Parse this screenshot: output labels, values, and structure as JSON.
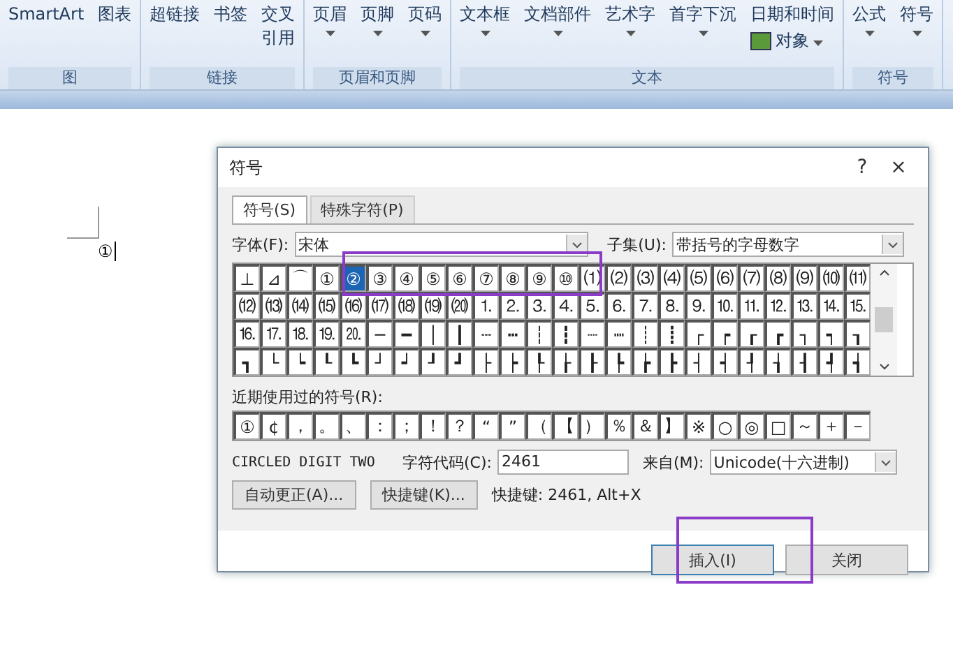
{
  "ribbon": {
    "groups": [
      {
        "label": "图",
        "buttons": [
          {
            "lines": [
              "SmartArt"
            ],
            "dropdown": false
          },
          {
            "lines": [
              "图表"
            ],
            "dropdown": false
          }
        ]
      },
      {
        "label": "链接",
        "buttons": [
          {
            "lines": [
              "超链接"
            ],
            "dropdown": false
          },
          {
            "lines": [
              "书签"
            ],
            "dropdown": false
          },
          {
            "lines": [
              "交叉",
              "引用"
            ],
            "dropdown": false
          }
        ]
      },
      {
        "label": "页眉和页脚",
        "buttons": [
          {
            "lines": [
              "页眉"
            ],
            "dropdown": true
          },
          {
            "lines": [
              "页脚"
            ],
            "dropdown": true
          },
          {
            "lines": [
              "页码"
            ],
            "dropdown": true
          }
        ]
      },
      {
        "label": "文本",
        "buttons": [
          {
            "lines": [
              "文本框"
            ],
            "dropdown": true
          },
          {
            "lines": [
              "文档部件"
            ],
            "dropdown": true
          },
          {
            "lines": [
              "艺术字"
            ],
            "dropdown": true
          },
          {
            "lines": [
              "首字下沉"
            ],
            "dropdown": true
          }
        ],
        "small_buttons": [
          {
            "label": "日期和时间",
            "dropdown": false
          },
          {
            "label": "对象",
            "dropdown": true
          }
        ]
      },
      {
        "label": "符号",
        "buttons": [
          {
            "lines": [
              "公式"
            ],
            "dropdown": true
          },
          {
            "lines": [
              "符号"
            ],
            "dropdown": true
          }
        ]
      }
    ]
  },
  "document": {
    "text": "①"
  },
  "dialog": {
    "title": "符号",
    "help": "?",
    "close": "×",
    "tabs": [
      {
        "label": "符号(S)",
        "selected": true
      },
      {
        "label": "特殊字符(P)",
        "selected": false
      }
    ],
    "font_label": "字体(F):",
    "font_value": "宋体",
    "subset_label": "子集(U):",
    "subset_value": "带括号的字母数字",
    "grid": [
      [
        {
          "symbol": "⊥",
          "selected": false
        },
        {
          "symbol": "⊿",
          "selected": false
        },
        {
          "symbol": "⌒",
          "selected": false
        },
        {
          "symbol": "①",
          "selected": false
        },
        {
          "symbol": "②",
          "selected": true
        },
        {
          "symbol": "③",
          "selected": false
        },
        {
          "symbol": "④",
          "selected": false
        },
        {
          "symbol": "⑤",
          "selected": false
        },
        {
          "symbol": "⑥",
          "selected": false
        },
        {
          "symbol": "⑦",
          "selected": false
        },
        {
          "symbol": "⑧",
          "selected": false
        },
        {
          "symbol": "⑨",
          "selected": false
        },
        {
          "symbol": "⑩",
          "selected": false
        },
        {
          "symbol": "⑴",
          "selected": false
        },
        {
          "symbol": "⑵",
          "selected": false
        },
        {
          "symbol": "⑶",
          "selected": false
        },
        {
          "symbol": "⑷",
          "selected": false
        },
        {
          "symbol": "⑸",
          "selected": false
        },
        {
          "symbol": "⑹",
          "selected": false
        },
        {
          "symbol": "⑺",
          "selected": false
        },
        {
          "symbol": "⑻",
          "selected": false
        },
        {
          "symbol": "⑼",
          "selected": false
        },
        {
          "symbol": "⑽",
          "selected": false
        },
        {
          "symbol": "⑾",
          "selected": false
        }
      ],
      [
        {
          "symbol": "⑿",
          "selected": false
        },
        {
          "symbol": "⒀",
          "selected": false
        },
        {
          "symbol": "⒁",
          "selected": false
        },
        {
          "symbol": "⒂",
          "selected": false
        },
        {
          "symbol": "⒃",
          "selected": false
        },
        {
          "symbol": "⒄",
          "selected": false
        },
        {
          "symbol": "⒅",
          "selected": false
        },
        {
          "symbol": "⒆",
          "selected": false
        },
        {
          "symbol": "⒇",
          "selected": false
        },
        {
          "symbol": "⒈",
          "selected": false
        },
        {
          "symbol": "⒉",
          "selected": false
        },
        {
          "symbol": "⒊",
          "selected": false
        },
        {
          "symbol": "⒋",
          "selected": false
        },
        {
          "symbol": "⒌",
          "selected": false
        },
        {
          "symbol": "⒍",
          "selected": false
        },
        {
          "symbol": "⒎",
          "selected": false
        },
        {
          "symbol": "⒏",
          "selected": false
        },
        {
          "symbol": "⒐",
          "selected": false
        },
        {
          "symbol": "⒑",
          "selected": false
        },
        {
          "symbol": "⒒",
          "selected": false
        },
        {
          "symbol": "⒓",
          "selected": false
        },
        {
          "symbol": "⒔",
          "selected": false
        },
        {
          "symbol": "⒕",
          "selected": false
        },
        {
          "symbol": "⒖",
          "selected": false
        }
      ],
      [
        {
          "symbol": "⒗",
          "selected": false
        },
        {
          "symbol": "⒘",
          "selected": false
        },
        {
          "symbol": "⒙",
          "selected": false
        },
        {
          "symbol": "⒚",
          "selected": false
        },
        {
          "symbol": "⒛",
          "selected": false
        },
        {
          "symbol": "─",
          "selected": false
        },
        {
          "symbol": "━",
          "selected": false
        },
        {
          "symbol": "│",
          "selected": false
        },
        {
          "symbol": "┃",
          "selected": false
        },
        {
          "symbol": "┄",
          "selected": false
        },
        {
          "symbol": "┅",
          "selected": false
        },
        {
          "symbol": "┆",
          "selected": false
        },
        {
          "symbol": "┇",
          "selected": false
        },
        {
          "symbol": "┈",
          "selected": false
        },
        {
          "symbol": "┉",
          "selected": false
        },
        {
          "symbol": "┊",
          "selected": false
        },
        {
          "symbol": "┋",
          "selected": false
        },
        {
          "symbol": "┌",
          "selected": false
        },
        {
          "symbol": "┍",
          "selected": false
        },
        {
          "symbol": "┎",
          "selected": false
        },
        {
          "symbol": "┏",
          "selected": false
        },
        {
          "symbol": "┐",
          "selected": false
        },
        {
          "symbol": "┑",
          "selected": false
        },
        {
          "symbol": "┒",
          "selected": false
        }
      ],
      [
        {
          "symbol": "┓",
          "selected": false
        },
        {
          "symbol": "└",
          "selected": false
        },
        {
          "symbol": "┕",
          "selected": false
        },
        {
          "symbol": "┖",
          "selected": false
        },
        {
          "symbol": "┗",
          "selected": false
        },
        {
          "symbol": "┘",
          "selected": false
        },
        {
          "symbol": "┙",
          "selected": false
        },
        {
          "symbol": "┚",
          "selected": false
        },
        {
          "symbol": "┛",
          "selected": false
        },
        {
          "symbol": "├",
          "selected": false
        },
        {
          "symbol": "┝",
          "selected": false
        },
        {
          "symbol": "┞",
          "selected": false
        },
        {
          "symbol": "┟",
          "selected": false
        },
        {
          "symbol": "┠",
          "selected": false
        },
        {
          "symbol": "┡",
          "selected": false
        },
        {
          "symbol": "┢",
          "selected": false
        },
        {
          "symbol": "┣",
          "selected": false
        },
        {
          "symbol": "┤",
          "selected": false
        },
        {
          "symbol": "┥",
          "selected": false
        },
        {
          "symbol": "┦",
          "selected": false
        },
        {
          "symbol": "┧",
          "selected": false
        },
        {
          "symbol": "┨",
          "selected": false
        },
        {
          "symbol": "┩",
          "selected": false
        },
        {
          "symbol": "┪",
          "selected": false
        }
      ]
    ],
    "recent_label": "近期使用过的符号(R):",
    "recent": [
      "①",
      "¢",
      "，",
      "。",
      "、",
      "：",
      "；",
      "！",
      "？",
      "“",
      "”",
      "（",
      "【",
      "）",
      "％",
      "＆",
      "】",
      "※",
      "○",
      "◎",
      "□",
      "～",
      "＋",
      "－"
    ],
    "char_name": "CIRCLED DIGIT TWO",
    "code_label": "字符代码(C):",
    "code_value": "2461",
    "from_label": "来自(M):",
    "from_value": "Unicode(十六进制)",
    "autocorrect_button": "自动更正(A)...",
    "shortcut_button": "快捷键(K)...",
    "shortcut_text": "快捷键: 2461, Alt+X",
    "insert_button": "插入(I)",
    "close_button": "关闭"
  }
}
